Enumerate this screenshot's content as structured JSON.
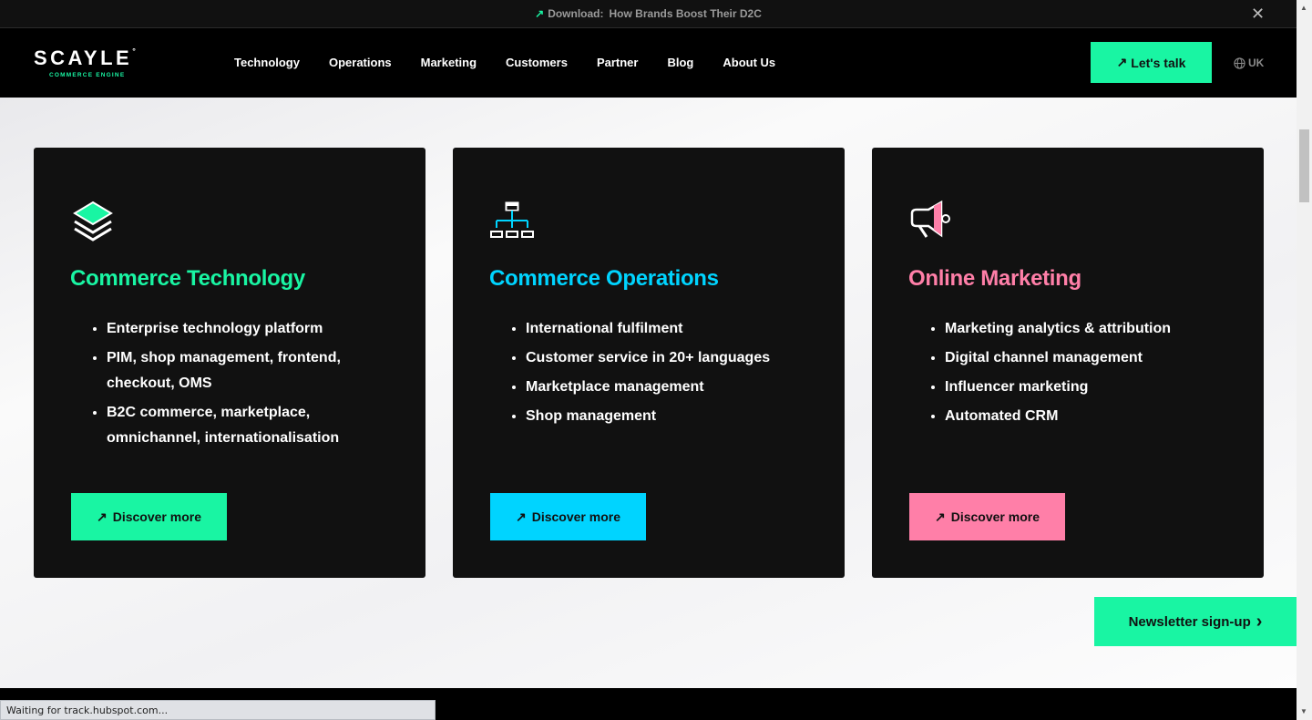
{
  "topbar": {
    "arrow": "↗",
    "lead": "Download:",
    "title": "How Brands Boost Their D2C",
    "close_glyph": "✕"
  },
  "header": {
    "logo_word": "SCAYLE",
    "logo_mark": "°",
    "logo_sub": "COMMERCE ENGINE",
    "nav": [
      "Technology",
      "Operations",
      "Marketing",
      "Customers",
      "Partner",
      "Blog",
      "About Us"
    ],
    "cta_arrow": "↗",
    "cta_label": "Let's talk",
    "lang_label": "UK",
    "lang_icon": "globe-icon"
  },
  "cards": [
    {
      "title": "Commerce Technology",
      "color": "#19f5a3",
      "icon": "layers-icon",
      "items": [
        "Enterprise technology platform",
        "PIM, shop management, frontend, checkout, OMS",
        "B2C commerce, marketplace, omnichannel, internationalisation"
      ],
      "button_arrow": "↗",
      "button_label": "Discover more"
    },
    {
      "title": "Commerce Operations",
      "color": "#00d4ff",
      "icon": "org-chart-icon",
      "items": [
        "International fulfilment",
        "Customer service in 20+ languages",
        "Marketplace management",
        "Shop management"
      ],
      "button_arrow": "↗",
      "button_label": "Discover more"
    },
    {
      "title": "Online Marketing",
      "color": "#ff7fa8",
      "icon": "megaphone-icon",
      "items": [
        "Marketing analytics & attribution",
        "Digital channel management",
        "Influencer marketing",
        "Automated CRM"
      ],
      "button_arrow": "↗",
      "button_label": "Discover more"
    }
  ],
  "newsletter": {
    "label": "Newsletter sign-up",
    "chevron": "›"
  },
  "status": {
    "text": "Waiting for track.hubspot.com..."
  }
}
